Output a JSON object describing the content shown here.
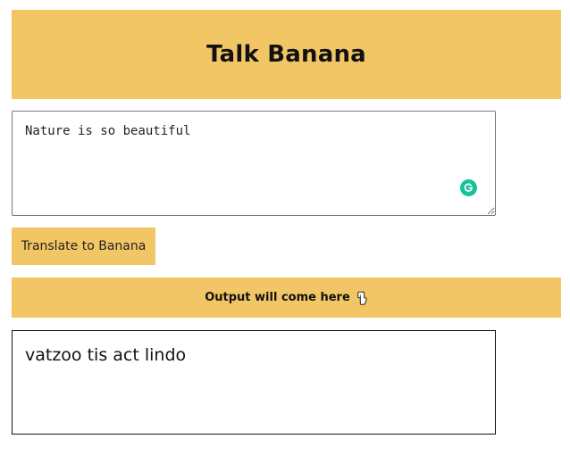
{
  "header": {
    "title": "Talk Banana"
  },
  "input": {
    "value": "Nature is so beautiful",
    "grammarly_icon": "grammarly-g-icon"
  },
  "translate_button": {
    "label": "Translate to Banana"
  },
  "output_banner": {
    "label": "Output will come here",
    "icon": "pointing-down-hand-icon"
  },
  "output": {
    "text": "vatzoo tis act lindo"
  },
  "colors": {
    "accent": "#f2c665",
    "grammarly": "#15c39a"
  }
}
